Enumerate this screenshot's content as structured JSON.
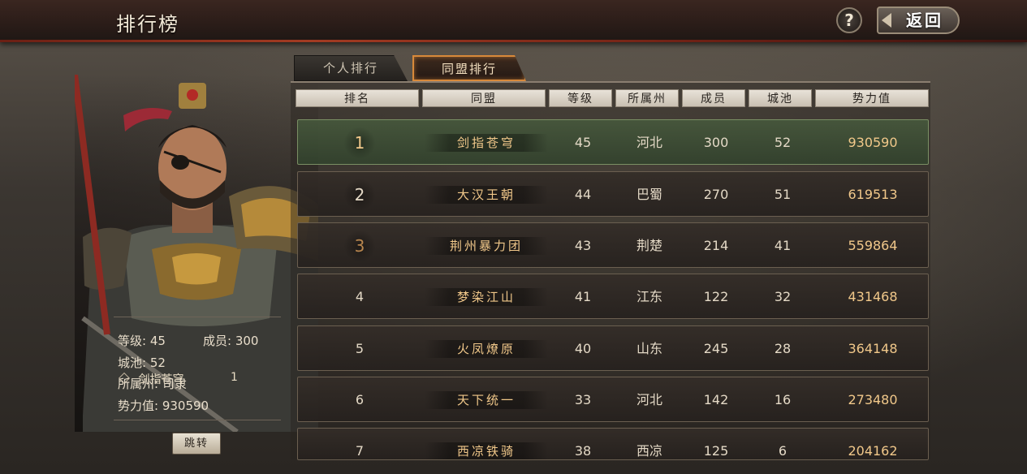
{
  "header": {
    "title": "排行榜",
    "help_label": "?",
    "back_label": "返回"
  },
  "tabs": [
    {
      "label": "个人排行",
      "active": false
    },
    {
      "label": "同盟排行",
      "active": true
    }
  ],
  "columns": [
    "排名",
    "同盟",
    "等级",
    "所属州",
    "成员",
    "城池",
    "势力值"
  ],
  "rows": [
    {
      "rank": "1",
      "name": "剑指苍穹",
      "level": "45",
      "state": "河北",
      "members": "300",
      "cities": "52",
      "power": "930590"
    },
    {
      "rank": "2",
      "name": "大汉王朝",
      "level": "44",
      "state": "巴蜀",
      "members": "270",
      "cities": "51",
      "power": "619513"
    },
    {
      "rank": "3",
      "name": "荆州暴力团",
      "level": "43",
      "state": "荆楚",
      "members": "214",
      "cities": "41",
      "power": "559864"
    },
    {
      "rank": "4",
      "name": "梦染江山",
      "level": "41",
      "state": "江东",
      "members": "122",
      "cities": "32",
      "power": "431468"
    },
    {
      "rank": "5",
      "name": "火凤燎原",
      "level": "40",
      "state": "山东",
      "members": "245",
      "cities": "28",
      "power": "364148"
    },
    {
      "rank": "6",
      "name": "天下统一",
      "level": "33",
      "state": "河北",
      "members": "142",
      "cities": "16",
      "power": "273480"
    },
    {
      "rank": "7",
      "name": "西凉铁骑",
      "level": "38",
      "state": "西凉",
      "members": "125",
      "cities": "6",
      "power": "204162"
    }
  ],
  "hero": {
    "alliance": "剑指苍穹",
    "rank": "1",
    "level": "等级: 45",
    "members": "成员: 300",
    "cities": "城池: 52",
    "state": "所属州: 司隶",
    "power": "势力值: 930590",
    "jump_label": "跳转"
  },
  "colors": {
    "accent": "#d8893a",
    "gold_text": "#f1c88a",
    "first_row": "#46583c"
  },
  "icons": {
    "help": "question-icon",
    "back": "back-arrow-icon"
  }
}
